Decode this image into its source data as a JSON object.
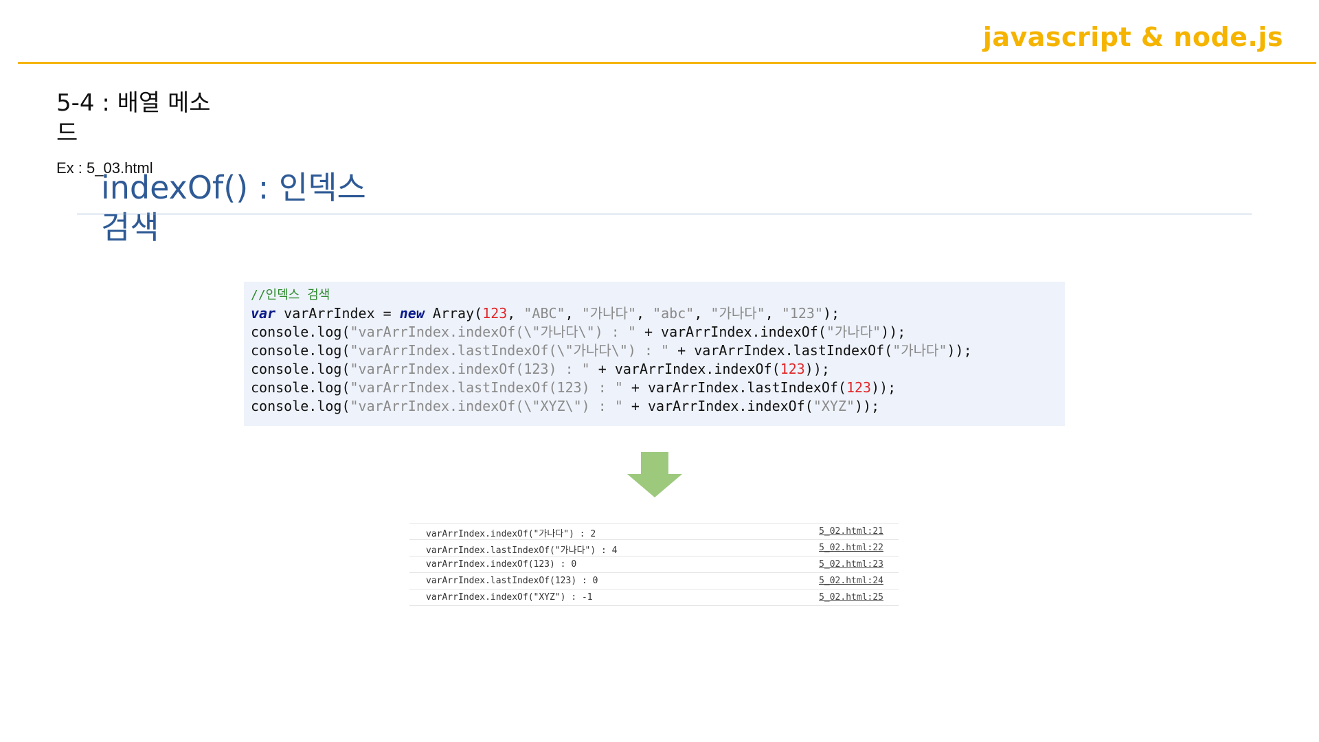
{
  "header": {
    "brand": "javascript & node.js",
    "accent_color": "#f5b400"
  },
  "section": {
    "title": "5-4 : 배열 메소드",
    "example": "Ex : 5_03.html"
  },
  "subtitle": {
    "text": "indexOf() : 인덱스 검색",
    "color": "#2e5a96"
  },
  "code": {
    "comment": "//인덱스 검색",
    "line1": {
      "kw_var": "var",
      "name": " varArrIndex = ",
      "kw_new": "new",
      "call": " Array(",
      "n1": "123",
      "sep1": ", ",
      "s1": "\"ABC\"",
      "sep2": ", ",
      "s2": "\"가나다\"",
      "sep3": ", ",
      "s3": "\"abc\"",
      "sep4": ", ",
      "s4": "\"가나다\"",
      "sep5": ", ",
      "s5": "\"123\"",
      "end": ");"
    },
    "line2": {
      "pre": "console.log(",
      "str": "\"varArrIndex.indexOf(\\\"가나다\\\") : \"",
      "mid": " + varArrIndex.indexOf(",
      "arg": "\"가나다\"",
      "end": "));"
    },
    "line3": {
      "pre": "console.log(",
      "str": "\"varArrIndex.lastIndexOf(\\\"가나다\\\") : \"",
      "mid": " + varArrIndex.lastIndexOf(",
      "arg": "\"가나다\"",
      "end": "));"
    },
    "line4": {
      "pre": "console.log(",
      "str": "\"varArrIndex.indexOf(123) : \"",
      "mid": " + varArrIndex.indexOf(",
      "arg": "123",
      "end": "));"
    },
    "line5": {
      "pre": "console.log(",
      "str": "\"varArrIndex.lastIndexOf(123) : \"",
      "mid": " + varArrIndex.lastIndexOf(",
      "arg": "123",
      "end": "));"
    },
    "line6": {
      "pre": "console.log(",
      "str": "\"varArrIndex.indexOf(\\\"XYZ\\\") : \"",
      "mid": " + varArrIndex.indexOf(",
      "arg": "\"XYZ\"",
      "end": "));"
    }
  },
  "console": {
    "rows": [
      {
        "message": "varArrIndex.indexOf(\"가나다\") : 2",
        "source": "5_02.html:21"
      },
      {
        "message": "varArrIndex.lastIndexOf(\"가나다\") : 4",
        "source": "5_02.html:22"
      },
      {
        "message": "varArrIndex.indexOf(123) : 0",
        "source": "5_02.html:23"
      },
      {
        "message": "varArrIndex.lastIndexOf(123) : 0",
        "source": "5_02.html:24"
      },
      {
        "message": "varArrIndex.indexOf(\"XYZ\") : -1",
        "source": "5_02.html:25"
      }
    ]
  },
  "arrow": {
    "icon": "arrow-down-icon",
    "color": "#9dc97d"
  }
}
